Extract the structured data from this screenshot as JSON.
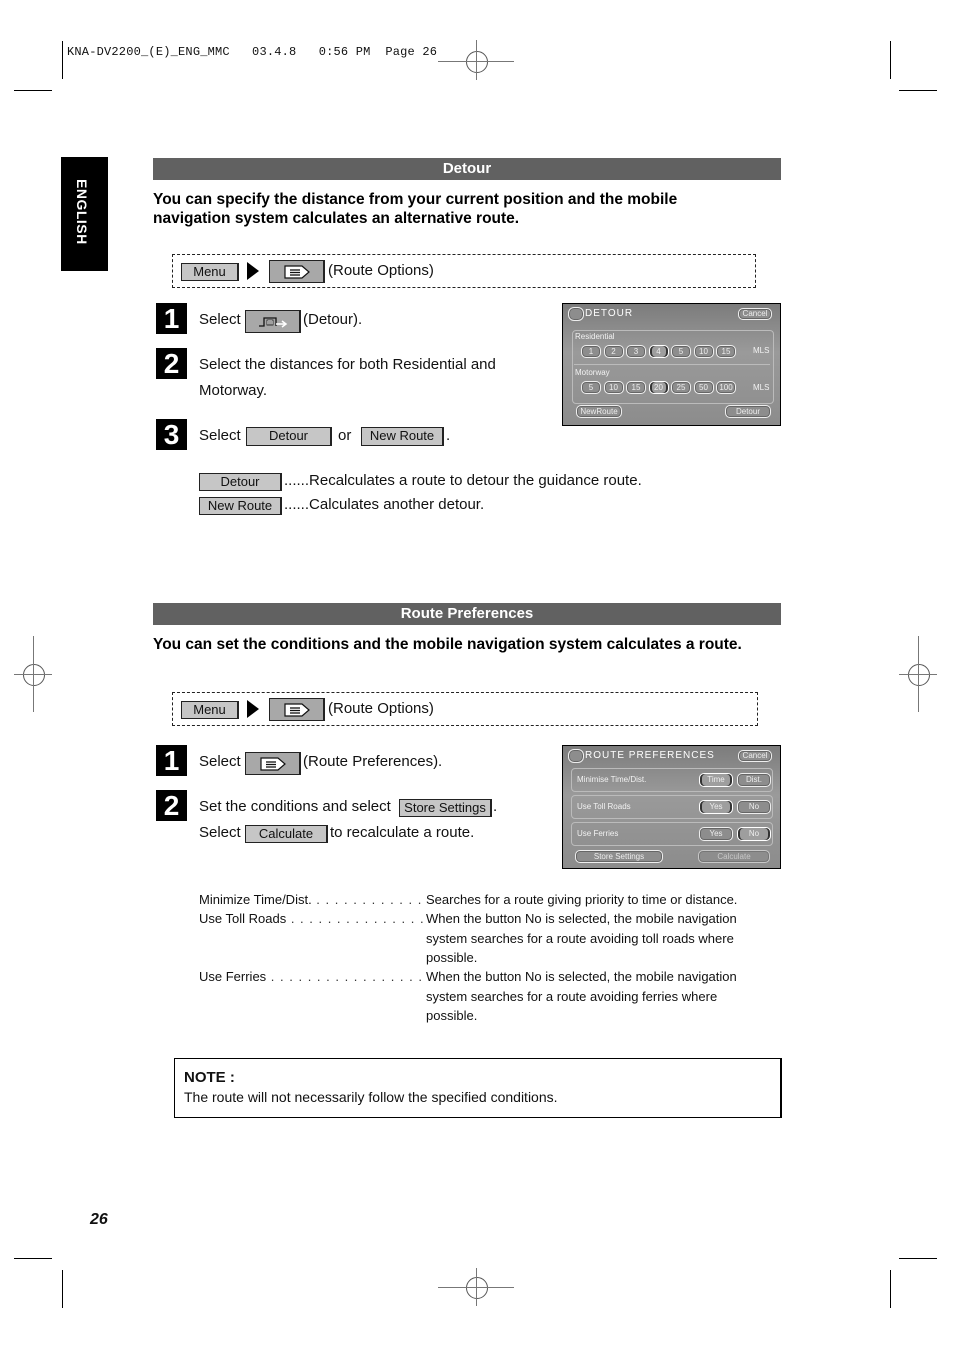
{
  "slug_line": {
    "file": "KNA-DV2200_(E)_ENG_MMC",
    "date": "03.4.8",
    "time": "0:56 PM",
    "page_label": "Page 26"
  },
  "language_tab": "ENGLISH",
  "page_number": "26",
  "detour_section": {
    "title": "Detour",
    "lead": "You can specify the distance from your current position and the mobile navigation system calculates an alternative route.",
    "path": {
      "menu_button": "Menu",
      "arrow_icon": "right-triangle-icon",
      "route_options_icon": "route-options-icon",
      "route_options_label": "(Route Options)"
    },
    "steps": [
      {
        "number": "1",
        "prefix": "Select",
        "icon": "detour-icon",
        "suffix": "(Detour)."
      },
      {
        "number": "2",
        "line1": "Select the distances for both Residential and",
        "line2": "Motorway."
      },
      {
        "number": "3",
        "prefix": "Select",
        "button_a": "Detour",
        "or": "or",
        "button_b": "New Route",
        "suffix": "."
      }
    ],
    "definitions": [
      {
        "button": "Detour",
        "leader": "......",
        "text": "Recalculates a route to detour the guidance route."
      },
      {
        "button": "New Route",
        "leader": "......",
        "text": "Calculates another detour."
      }
    ],
    "screen": {
      "title": "DETOUR",
      "cancel": "Cancel",
      "residential_label": "Residential",
      "residential_options": [
        "1",
        "2",
        "3",
        "4",
        "5",
        "10",
        "15"
      ],
      "residential_selected": "4",
      "motorway_label": "Motorway",
      "motorway_options": [
        "5",
        "10",
        "15",
        "20",
        "25",
        "50",
        "100"
      ],
      "motorway_selected": "20",
      "unit": "MLS",
      "new_route": "NewRoute",
      "detour": "Detour"
    }
  },
  "route_pref_section": {
    "title": "Route Preferences",
    "lead": "You can set the conditions and the mobile navigation system calculates a route.",
    "path": {
      "menu_button": "Menu",
      "arrow_icon": "right-triangle-icon",
      "route_options_icon": "route-options-icon",
      "route_options_label": "(Route Options)"
    },
    "steps": [
      {
        "number": "1",
        "prefix": "Select",
        "icon": "route-preferences-icon",
        "suffix": "(Route Preferences)."
      },
      {
        "number": "2",
        "line1_prefix": "Set the conditions and select",
        "line1_button": "Store Settings",
        "line1_suffix": ".",
        "line2_prefix": "Select",
        "line2_button": "Calculate",
        "line2_suffix": "to recalculate a route."
      }
    ],
    "definitions": [
      {
        "term": "Minimize Time/Dist.",
        "leader": " . . . . . . . . . . . . . .",
        "lines": [
          "Searches for a route giving priority to time or distance."
        ]
      },
      {
        "term": "Use Toll Roads",
        "leader": " . . . . . . . . . . . . . . . . . . .",
        "lines": [
          "When the button No is selected, the mobile navigation",
          "system searches for a route avoiding toll roads where",
          "possible."
        ]
      },
      {
        "term": "Use Ferries",
        "leader": " . . . . . . . . . . . . . . . . . . . . . .",
        "lines": [
          "When the button No is selected, the mobile navigation",
          "system searches for a route avoiding ferries where",
          "possible."
        ]
      }
    ],
    "screen": {
      "title": "ROUTE PREFERENCES",
      "cancel": "Cancel",
      "rows": [
        {
          "label": "Minimise Time/Dist.",
          "opt_a": "Time",
          "opt_b": "Dist.",
          "selected": "Time"
        },
        {
          "label": "Use Toll Roads",
          "opt_a": "Yes",
          "opt_b": "No",
          "selected": "Yes"
        },
        {
          "label": "Use Ferries",
          "opt_a": "Yes",
          "opt_b": "No",
          "selected": "No"
        }
      ],
      "store_settings": "Store Settings",
      "calculate": "Calculate"
    }
  },
  "note": {
    "heading": "NOTE :",
    "text": "The route will not necessarily follow the specified conditions."
  }
}
